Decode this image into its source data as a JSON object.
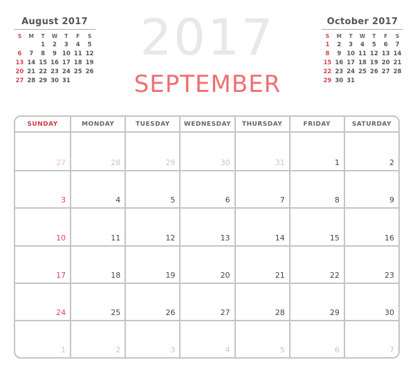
{
  "year": "2017",
  "month": "SEPTEMBER",
  "colors": {
    "accent": "#ef6f72",
    "sunday": "#d9434f",
    "grid": "#c4c4c4",
    "year": "#e8e8e8"
  },
  "prev_month": {
    "title": "August 2017",
    "dow": [
      "S",
      "M",
      "T",
      "W",
      "T",
      "F",
      "S"
    ],
    "days": [
      "",
      "",
      "1",
      "2",
      "3",
      "4",
      "5",
      "6",
      "7",
      "8",
      "9",
      "10",
      "11",
      "12",
      "13",
      "14",
      "15",
      "16",
      "17",
      "18",
      "19",
      "20",
      "21",
      "22",
      "23",
      "24",
      "25",
      "26",
      "27",
      "28",
      "29",
      "30",
      "31"
    ]
  },
  "next_month": {
    "title": "October 2017",
    "dow": [
      "S",
      "M",
      "T",
      "W",
      "T",
      "F",
      "S"
    ],
    "days": [
      "1",
      "2",
      "3",
      "4",
      "5",
      "6",
      "7",
      "8",
      "9",
      "10",
      "11",
      "12",
      "13",
      "14",
      "15",
      "16",
      "17",
      "18",
      "19",
      "20",
      "21",
      "22",
      "23",
      "24",
      "25",
      "26",
      "27",
      "28",
      "29",
      "30",
      "31"
    ]
  },
  "weekdays": [
    "SUNDAY",
    "MONDAY",
    "TUESDAY",
    "WEDNESDAY",
    "THURSDAY",
    "FRIDAY",
    "SATURDAY"
  ],
  "weeks": [
    [
      {
        "d": "27",
        "out": true
      },
      {
        "d": "28",
        "out": true
      },
      {
        "d": "29",
        "out": true
      },
      {
        "d": "30",
        "out": true
      },
      {
        "d": "31",
        "out": true
      },
      {
        "d": "1"
      },
      {
        "d": "2"
      }
    ],
    [
      {
        "d": "3"
      },
      {
        "d": "4"
      },
      {
        "d": "5"
      },
      {
        "d": "6"
      },
      {
        "d": "7"
      },
      {
        "d": "8"
      },
      {
        "d": "9"
      }
    ],
    [
      {
        "d": "10"
      },
      {
        "d": "11"
      },
      {
        "d": "12"
      },
      {
        "d": "13"
      },
      {
        "d": "14"
      },
      {
        "d": "15"
      },
      {
        "d": "16"
      }
    ],
    [
      {
        "d": "17"
      },
      {
        "d": "18"
      },
      {
        "d": "19"
      },
      {
        "d": "20"
      },
      {
        "d": "21"
      },
      {
        "d": "22"
      },
      {
        "d": "23"
      }
    ],
    [
      {
        "d": "24"
      },
      {
        "d": "25"
      },
      {
        "d": "26"
      },
      {
        "d": "27"
      },
      {
        "d": "28"
      },
      {
        "d": "29"
      },
      {
        "d": "30"
      }
    ],
    [
      {
        "d": "1",
        "out": true
      },
      {
        "d": "2",
        "out": true
      },
      {
        "d": "3",
        "out": true
      },
      {
        "d": "4",
        "out": true
      },
      {
        "d": "5",
        "out": true
      },
      {
        "d": "6",
        "out": true
      },
      {
        "d": "7",
        "out": true
      }
    ]
  ]
}
